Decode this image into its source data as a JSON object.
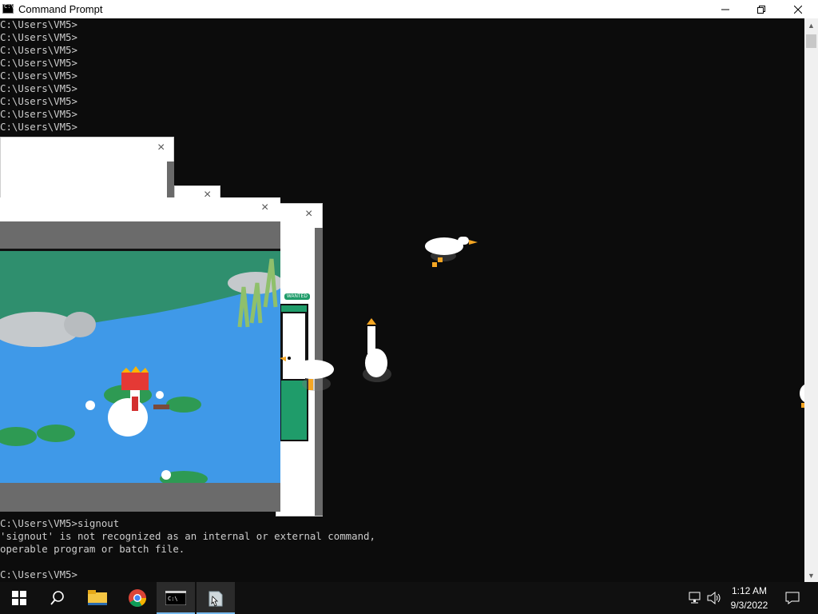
{
  "window": {
    "title": "Command Prompt"
  },
  "console": {
    "prompt_lines": [
      "C:\\Users\\VM5>",
      "C:\\Users\\VM5>",
      "C:\\Users\\VM5>",
      "C:\\Users\\VM5>",
      "C:\\Users\\VM5>",
      "C:\\Users\\VM5>",
      "C:\\Users\\VM5>",
      "C:\\Users\\VM5>",
      "C:\\Users\\VM5>"
    ],
    "command_line": "C:\\Users\\VM5>signout",
    "error_line1": "'signout' is not recognized as an internal or external command,",
    "error_line2": "operable program or batch file.",
    "last_prompt": "C:\\Users\\VM5>"
  },
  "popups": {
    "note_sign": "WANTED",
    "close_glyph": "×"
  },
  "taskbar": {
    "items": [
      "start-button",
      "search-button",
      "file-explorer",
      "chrome",
      "command-prompt",
      "desktop-goose"
    ],
    "time": "1:12 AM",
    "date": "9/3/2022"
  },
  "colors": {
    "accent": "#76b9ed",
    "console_bg": "#0c0c0c",
    "console_text": "#cccccc"
  }
}
